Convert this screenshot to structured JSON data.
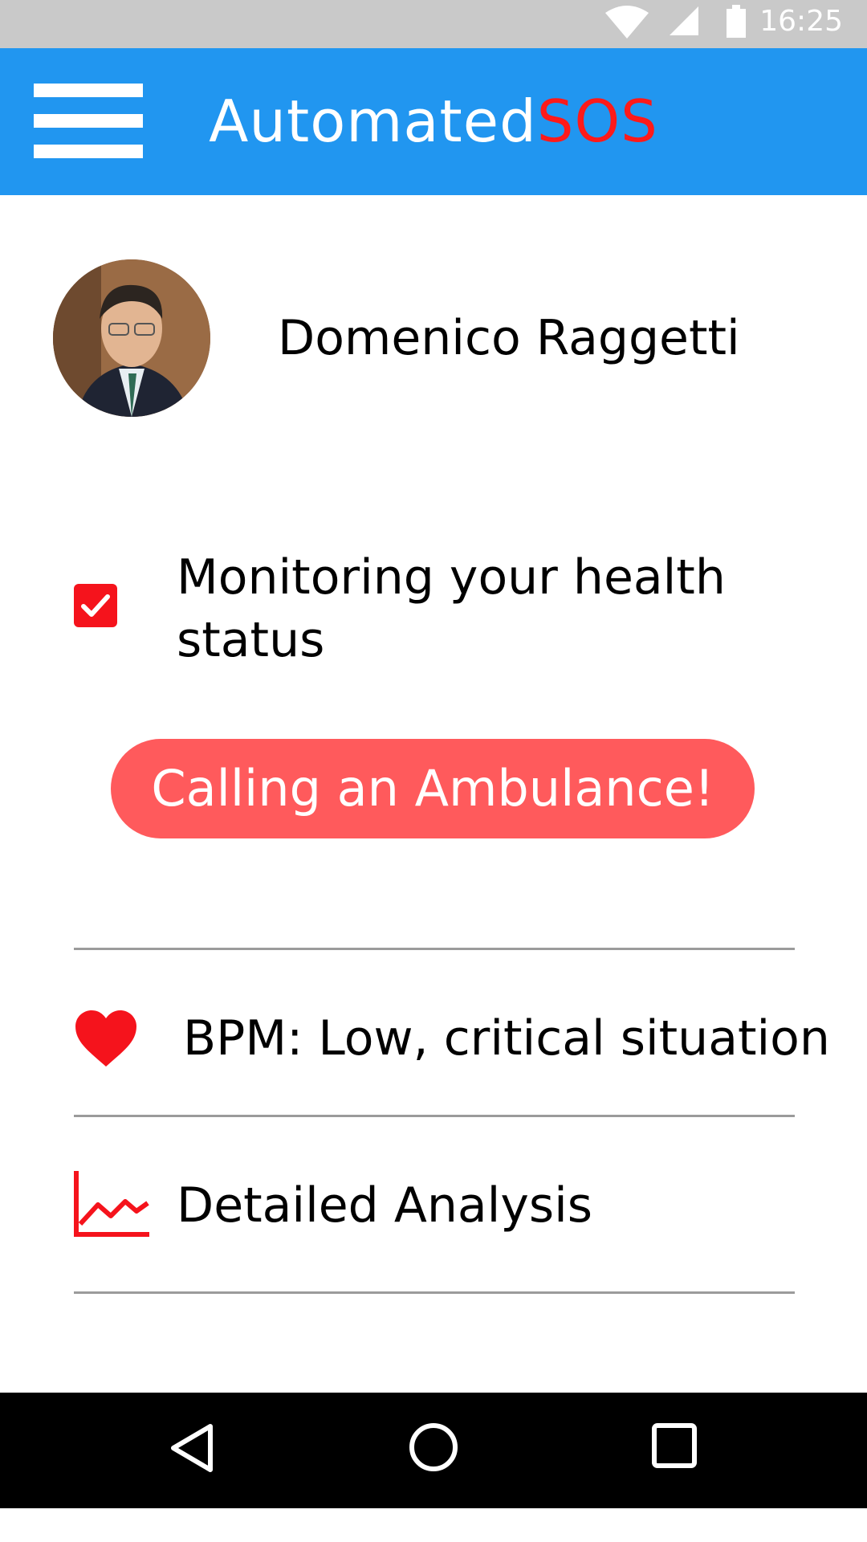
{
  "status_bar": {
    "time": "16:25"
  },
  "app_bar": {
    "title_part1": "Automated",
    "title_part2": "SOS",
    "accent_color": "#ff1a1a"
  },
  "profile": {
    "name": "Domenico Raggetti"
  },
  "monitoring": {
    "label": "Monitoring your health status",
    "checked": true
  },
  "alert": {
    "button_label": "Calling an Ambulance!"
  },
  "list": {
    "bpm_label": "BPM: Low, critical situation",
    "analysis_label": "Detailed Analysis"
  },
  "colors": {
    "app_bar": "#2196f0",
    "alert_red": "#f5131c",
    "button": "#ff5a5c"
  },
  "icons": [
    "wifi-icon",
    "signal-icon",
    "battery-icon",
    "menu-icon",
    "check-icon",
    "heart-icon",
    "chart-icon",
    "back-icon",
    "home-icon",
    "recents-icon"
  ]
}
